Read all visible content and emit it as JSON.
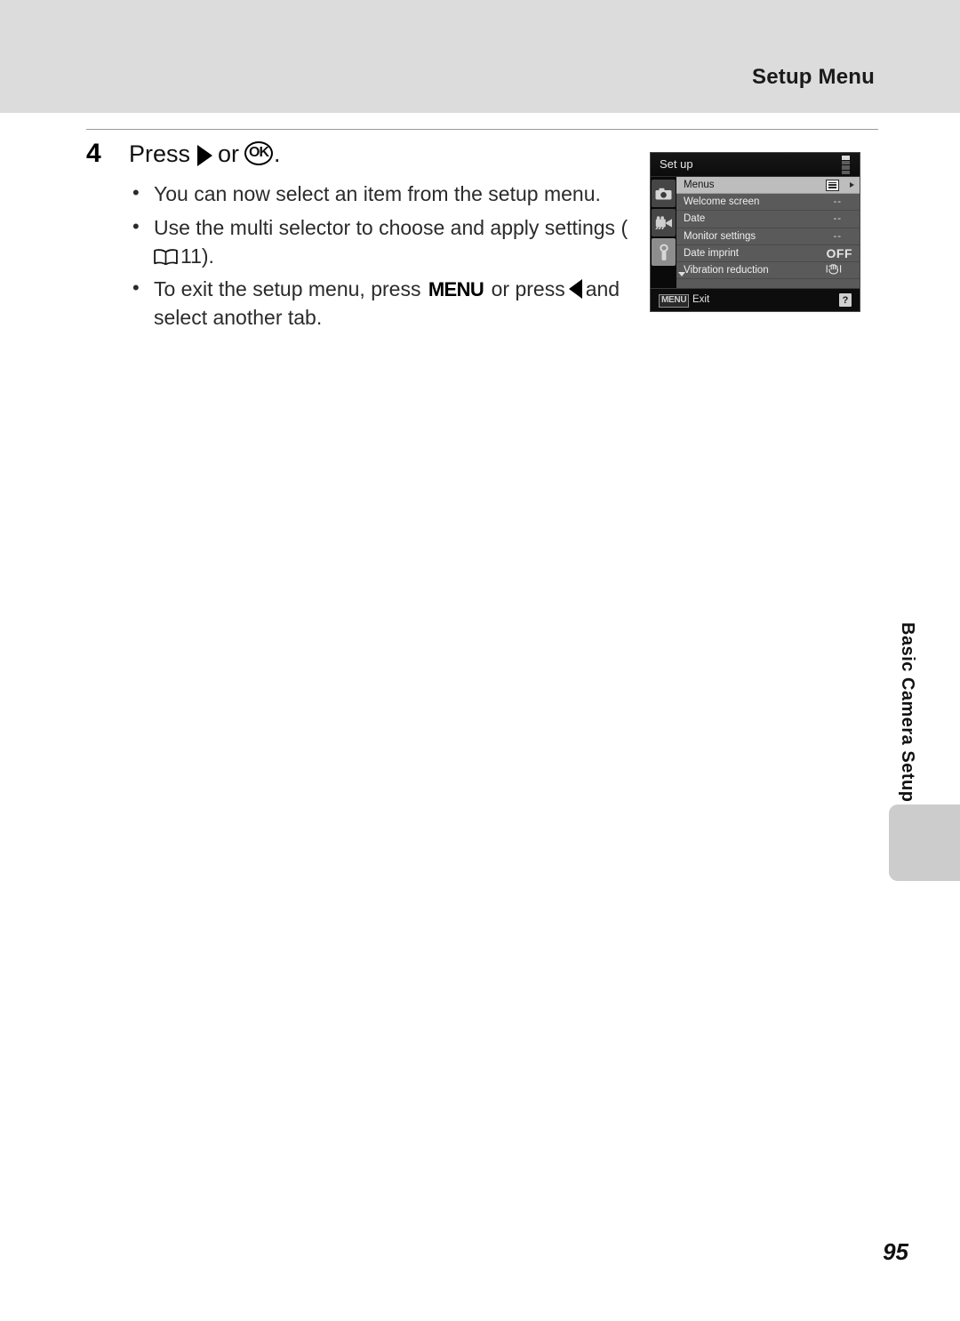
{
  "page": {
    "header_title": "Setup Menu",
    "page_number": "95",
    "side_chapter_label": "Basic Camera Setup"
  },
  "step": {
    "number": "4",
    "title_prefix": "Press",
    "title_icon_right": "triangle-right-glyph",
    "title_or": "or",
    "title_icon_ok": "OK",
    "title_suffix": ".",
    "bullets": [
      {
        "id": "bullet-select-item",
        "text": "You can now select an item from the setup menu."
      },
      {
        "id": "bullet-multi-selector",
        "text_before": "Use the multi selector to choose and apply settings (",
        "book_icon": "open-book-glyph",
        "reference_page": "11",
        "text_after": ")."
      },
      {
        "id": "bullet-exit",
        "text_before": "To exit the setup menu, press",
        "menu_glyph": "MENU",
        "text_middle": "or press",
        "left_glyph": "triangle-left-glyph",
        "text_after": "and select another tab."
      }
    ]
  },
  "lcd": {
    "title": "Set up",
    "scroll_segments": 4,
    "scroll_active_index": 0,
    "tabs": [
      {
        "id": "tab-shooting",
        "icon": "camera-icon",
        "active": false
      },
      {
        "id": "tab-movie",
        "icon": "movie-camera-icon",
        "active": false
      },
      {
        "id": "tab-setup",
        "icon": "wrench-icon",
        "active": true
      }
    ],
    "rows": [
      {
        "label": "Menus",
        "value": "",
        "selected": true,
        "icon": "list-menu-icon",
        "arrow": true
      },
      {
        "label": "Welcome screen",
        "value": "--",
        "selected": false
      },
      {
        "label": "Date",
        "value": "--",
        "selected": false
      },
      {
        "label": "Monitor settings",
        "value": "--",
        "selected": false
      },
      {
        "label": "Date imprint",
        "value": "OFF",
        "selected": false,
        "value_style": "off"
      },
      {
        "label": "Vibration reduction",
        "value": "",
        "selected": false,
        "icon": "vr-hand-icon",
        "more_below": true
      }
    ],
    "footer": {
      "menu_badge": "MENU",
      "exit_label": "Exit",
      "help_badge": "?"
    }
  },
  "colors": {
    "header_band": "#dcdcdc",
    "lcd_background": "#0a0a0a",
    "lcd_list": "#5a5a5a",
    "lcd_selected_row": "#bdbdbd",
    "side_tab": "#cccccc",
    "body_text": "#2b2b2b"
  }
}
